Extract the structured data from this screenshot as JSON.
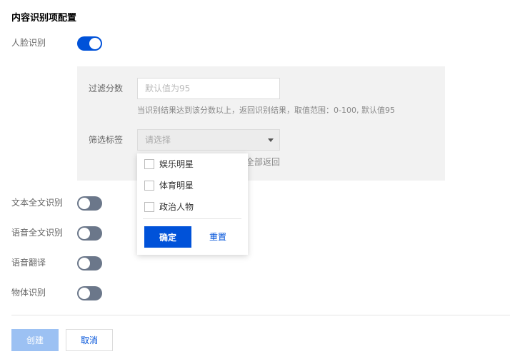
{
  "page": {
    "title": "内容识别项配置"
  },
  "face_recognition": {
    "label": "人脸识别",
    "enabled": true,
    "score": {
      "label": "过滤分数",
      "placeholder": "默认值为95",
      "help": "当识别结果达到该分数以上，返回识别结果，取值范围：0-100, 默认值95"
    },
    "tags": {
      "label": "筛选标签",
      "placeholder": "请选择",
      "help_visible_fragment": "全部返回",
      "options": [
        {
          "label": "娱乐明星",
          "checked": false
        },
        {
          "label": "体育明星",
          "checked": false
        },
        {
          "label": "政治人物",
          "checked": false
        }
      ],
      "confirm_label": "确定",
      "reset_label": "重置"
    }
  },
  "toggles": [
    {
      "label": "文本全文识别",
      "enabled": false
    },
    {
      "label": "语音全文识别",
      "enabled": false
    },
    {
      "label": "语音翻译",
      "enabled": false
    },
    {
      "label": "物体识别",
      "enabled": false
    }
  ],
  "footer": {
    "create_label": "创建",
    "cancel_label": "取消"
  },
  "colors": {
    "primary": "#0052d9",
    "primary_disabled": "#9cc1f3",
    "switch_off": "#6b778a",
    "panel_bg": "#f2f2f2"
  }
}
